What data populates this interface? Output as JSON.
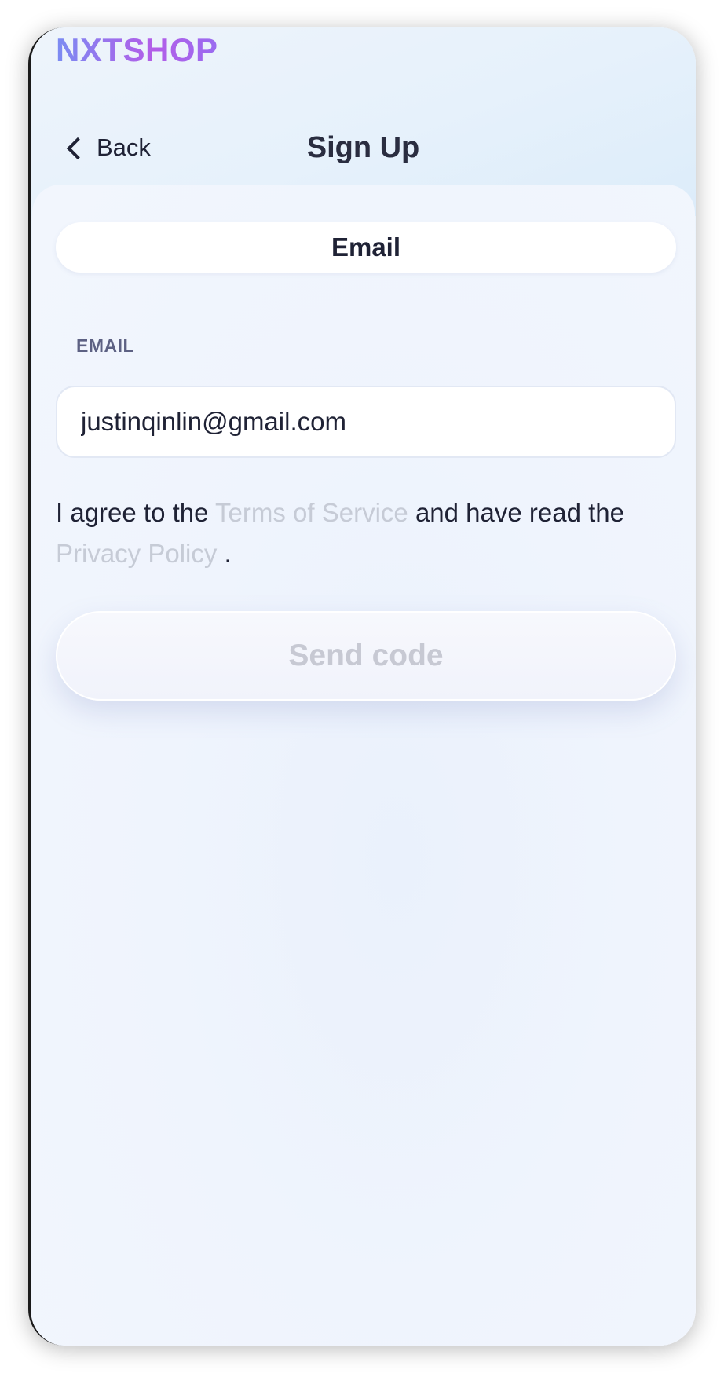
{
  "app": {
    "logo_text": "NXTSHOP"
  },
  "header": {
    "back_label": "Back",
    "title": "Sign Up"
  },
  "tabs": {
    "email_label": "Email"
  },
  "form": {
    "email_label": "EMAIL",
    "email_value": "justinqinlin@gmail.com"
  },
  "agreement": {
    "prefix": "I agree to the ",
    "terms_link": "Terms of Service",
    "middle": " and have read the ",
    "privacy_link": "Privacy Policy",
    "suffix": " ."
  },
  "actions": {
    "send_code_label": "Send code"
  },
  "colors": {
    "link_disabled": "#c6cbd6",
    "primary_text": "#1f2235",
    "logo_gradient_start": "#7b8cf2",
    "logo_gradient_end": "#b35de8",
    "button_disabled_text": "#c7c9d3"
  },
  "icons": {
    "back": "chevron-left-icon"
  }
}
